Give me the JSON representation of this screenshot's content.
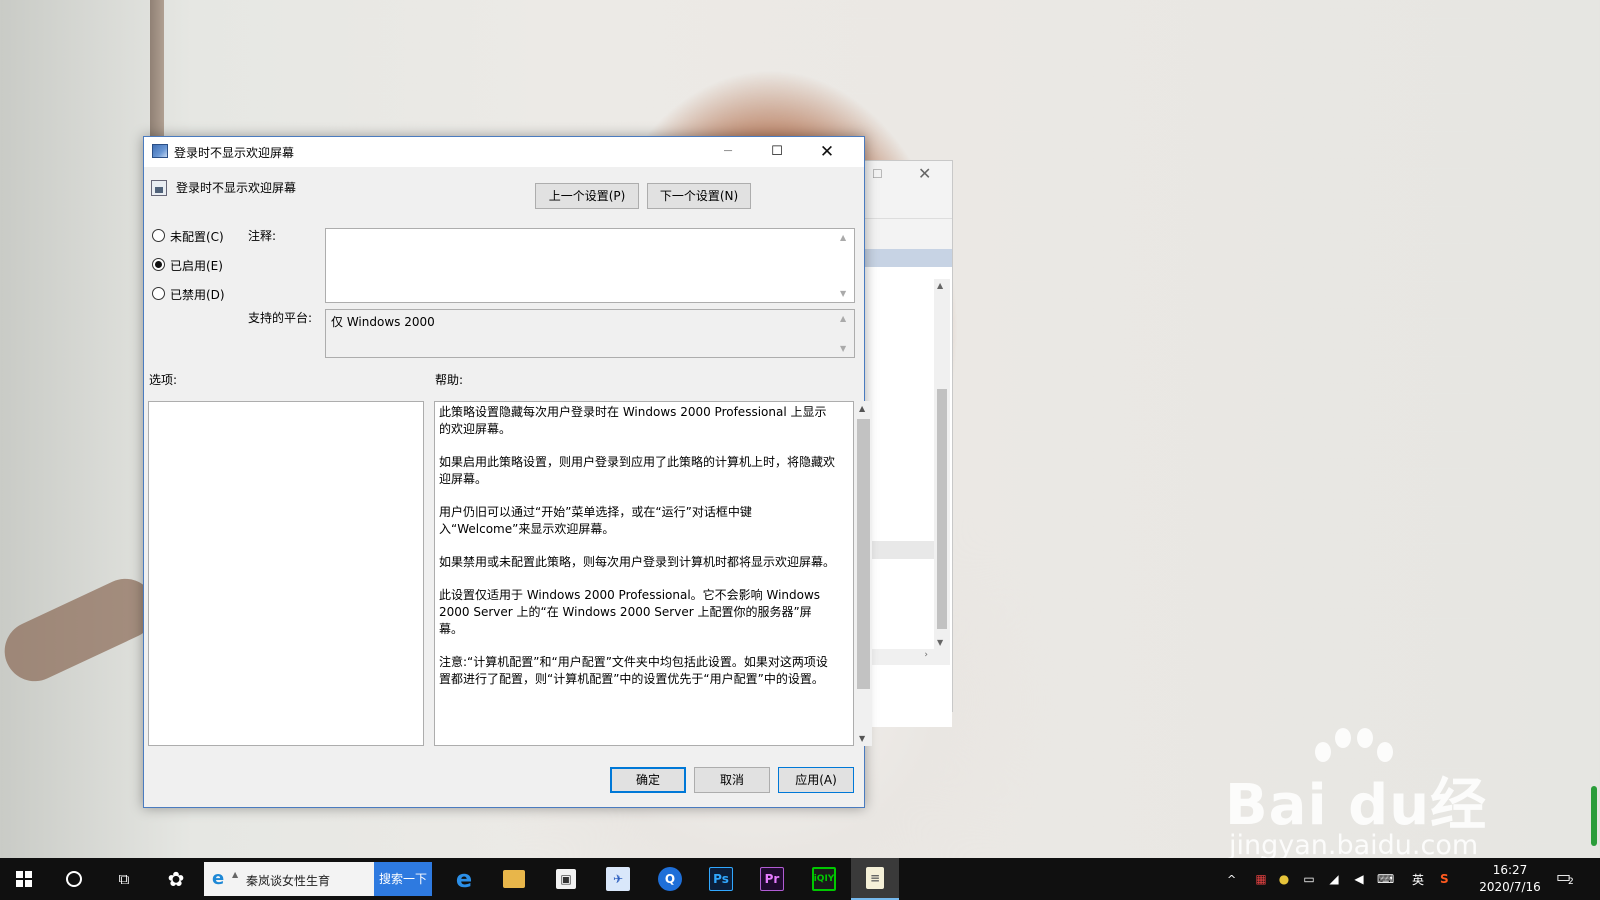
{
  "dialog": {
    "title": "登录时不显示欢迎屏幕",
    "setting_name": "登录时不显示欢迎屏幕",
    "window_controls": {
      "minimize": "─",
      "maximize": "☐",
      "close": "✕"
    },
    "prev_button": "上一个设置(P)",
    "next_button": "下一个设置(N)",
    "radios": [
      {
        "label": "未配置(C)",
        "selected": false
      },
      {
        "label": "已启用(E)",
        "selected": true
      },
      {
        "label": "已禁用(D)",
        "selected": false
      }
    ],
    "comment_label": "注释:",
    "comment_value": "",
    "platform_label": "支持的平台:",
    "platform_value": "仅 Windows 2000",
    "options_label": "选项:",
    "help_label": "帮助:",
    "help_paragraphs": [
      "此策略设置隐藏每次用户登录时在 Windows 2000 Professional 上显示的欢迎屏幕。",
      "如果启用此策略设置，则用户登录到应用了此策略的计算机上时，将隐藏欢迎屏幕。",
      "用户仍旧可以通过“开始”菜单选择，或在“运行”对话框中键入“Welcome”来显示欢迎屏幕。",
      "如果禁用或未配置此策略，则每次用户登录到计算机时都将显示欢迎屏幕。",
      "此设置仅适用于 Windows 2000 Professional。它不会影响 Windows 2000 Server 上的“在 Windows 2000 Server 上配置你的服务器”屏幕。",
      "注意:“计算机配置”和“用户配置”文件夹中均包括此设置。如果对这两项设置都进行了配置，则“计算机配置”中的设置优先于“用户配置”中的设置。"
    ],
    "ok_button": "确定",
    "cancel_button": "取消",
    "apply_button": "应用(A)"
  },
  "background_window": {
    "maximize": "☐",
    "close": "✕"
  },
  "watermark": {
    "main": "Bai du经验",
    "sub": "jingyan.baidu.com"
  },
  "taskbar": {
    "search_text": "秦岚谈女性生育",
    "search_button": "搜索一下",
    "apps": [
      {
        "name": "edge",
        "glyph": "e"
      },
      {
        "name": "file-explorer",
        "glyph": ""
      },
      {
        "name": "store",
        "glyph": "▣"
      },
      {
        "name": "feather",
        "glyph": "✈"
      },
      {
        "name": "q-app",
        "glyph": "Q"
      },
      {
        "name": "photoshop",
        "glyph": "Ps"
      },
      {
        "name": "premiere",
        "glyph": "Pr"
      },
      {
        "name": "iqiyi",
        "glyph": "iQIY"
      },
      {
        "name": "notepad",
        "glyph": "≡"
      }
    ],
    "tray": {
      "chevron": "^",
      "language": "英",
      "sogou": "S",
      "time": "16:27",
      "date": "2020/7/16",
      "notification_count": "2"
    }
  },
  "colors": {
    "accent": "#0078d7",
    "dialog_border": "#4a7bbf",
    "taskbar": "#101010",
    "search_button": "#2e7ae0"
  }
}
